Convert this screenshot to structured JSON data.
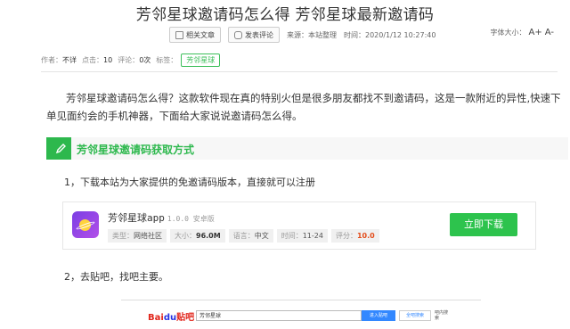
{
  "article": {
    "title": "芳邻星球邀请码怎么得 芳邻星球最新邀请码",
    "toolbar": {
      "related_label": "相关文章",
      "comment_label": "发表评论",
      "source_label": "来源：本站整理",
      "time_label": "时间：2020/1/12 10:27:40"
    },
    "font_size": {
      "label": "字体大小：",
      "plus": "A+",
      "minus": "A-"
    },
    "meta": {
      "author_key": "作者：",
      "author_val": "不详",
      "clicks_key": "点击：",
      "clicks_val": "10",
      "comments_key": "评论：",
      "comments_val": "0次",
      "tags_key": "标签：",
      "tag": "芳邻星球"
    },
    "intro": "芳邻星球邀请码怎么得？这款软件现在真的特别火但是很多朋友都找不到邀请码，这是一款附近的异性,快速下单见面约会的手机神器，下面给大家说说邀请码怎么得。",
    "section_title": "芳邻星球邀请码获取方式",
    "step1": "1，下载本站为大家提供的免邀请码版本，直接就可以注册",
    "step2": "2，去贴吧，找吧主要。"
  },
  "app_card": {
    "name": "芳邻星球app",
    "version": "1.0.0 安卓版",
    "type_key": "类型：",
    "type_val": "网络社区",
    "size_key": "大小：",
    "size_val": "96.0M",
    "lang_key": "语言：",
    "lang_val": "中文",
    "time_key": "时间：",
    "time_val": "11-24",
    "score_key": "评分：",
    "score_val": "10.0",
    "download_label": "立即下载"
  },
  "tieba_shot": {
    "logo_bai": "Bai",
    "logo_du": "du",
    "logo_tieba": "贴吧",
    "search_value": "芳邻星球",
    "enter_label": "进入贴吧",
    "search_all_label": "全吧搜索",
    "link_label": "吧内搜索"
  },
  "colors": {
    "accent_green": "#2db84d",
    "score_red": "#e34d1b",
    "tieba_blue": "#3388ff"
  }
}
